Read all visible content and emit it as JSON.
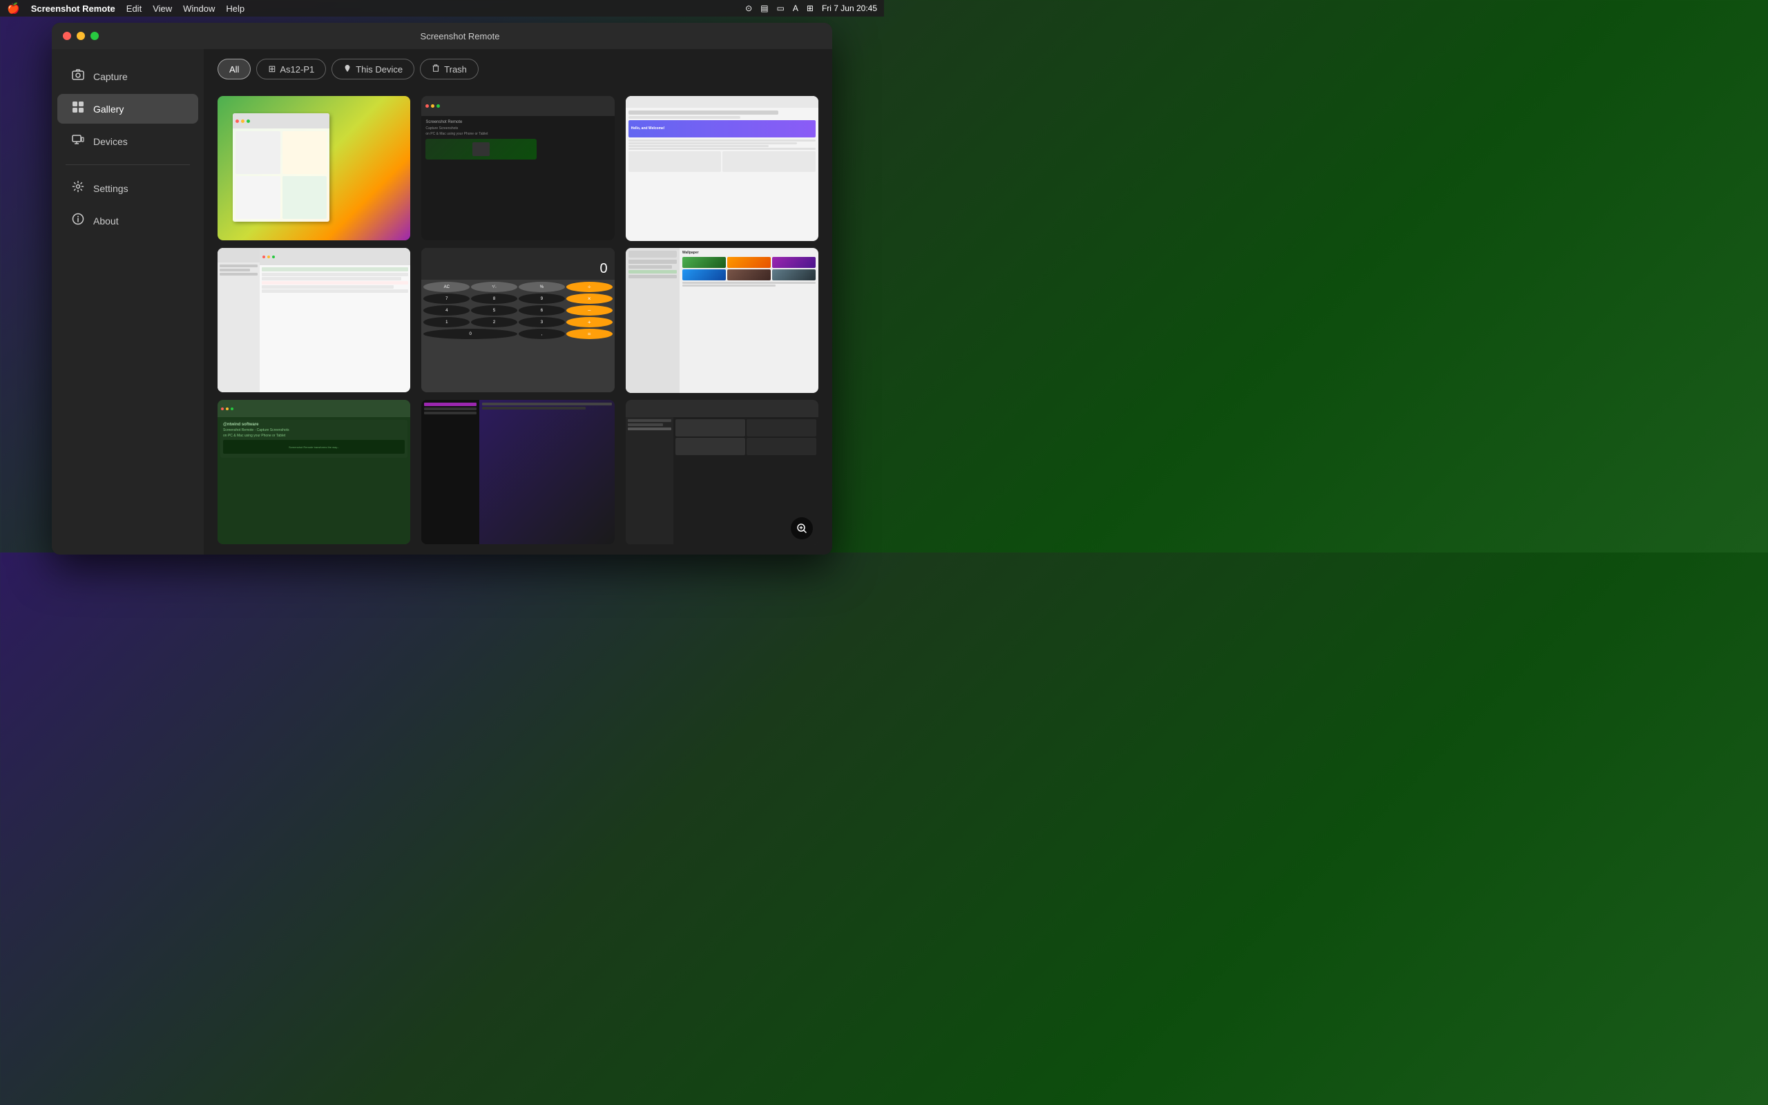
{
  "menubar": {
    "apple": "🍎",
    "app_name": "Screenshot Remote",
    "menus": [
      "Edit",
      "View",
      "Window",
      "Help"
    ],
    "datetime": "Fri 7 Jun  20:45",
    "icons": [
      "screenshot",
      "display",
      "monitor",
      "A",
      "controlcenter"
    ]
  },
  "window": {
    "title": "Screenshot Remote",
    "controls": {
      "close": "close",
      "minimize": "minimize",
      "maximize": "maximize"
    }
  },
  "sidebar": {
    "items": [
      {
        "id": "capture",
        "label": "Capture",
        "icon": "📷",
        "active": false
      },
      {
        "id": "gallery",
        "label": "Gallery",
        "icon": "🖼",
        "active": true
      },
      {
        "id": "devices",
        "label": "Devices",
        "icon": "🖥",
        "active": false
      },
      {
        "id": "settings",
        "label": "Settings",
        "icon": "⚙️",
        "active": false
      },
      {
        "id": "about",
        "label": "About",
        "icon": "❓",
        "active": false
      }
    ]
  },
  "filter": {
    "buttons": [
      {
        "id": "all",
        "label": "All",
        "active": true,
        "icon": ""
      },
      {
        "id": "as12p1",
        "label": "As12-P1",
        "active": false,
        "icon": "⊞"
      },
      {
        "id": "thisdevice",
        "label": "This Device",
        "active": false,
        "icon": "🍎"
      },
      {
        "id": "trash",
        "label": "Trash",
        "active": false,
        "icon": "🗑"
      }
    ]
  },
  "gallery": {
    "thumbnails": [
      {
        "id": 1,
        "type": "colorful-ui",
        "row": 1
      },
      {
        "id": 2,
        "type": "dark-app",
        "row": 1
      },
      {
        "id": 3,
        "type": "website",
        "row": 1
      },
      {
        "id": 4,
        "type": "file-manager",
        "row": 2
      },
      {
        "id": 5,
        "type": "calculator",
        "row": 2
      },
      {
        "id": 6,
        "type": "system-prefs",
        "row": 2
      },
      {
        "id": 7,
        "type": "app-screenshot",
        "row": 3
      },
      {
        "id": 8,
        "type": "terminal",
        "row": 3
      },
      {
        "id": 9,
        "type": "dark-ui",
        "row": 3,
        "zoom": true
      }
    ]
  },
  "icons": {
    "zoom": "🔍",
    "capture_icon": "📷",
    "gallery_icon": "🖼",
    "devices_icon": "🖥",
    "settings_icon": "⚙️",
    "about_icon": "❓"
  }
}
